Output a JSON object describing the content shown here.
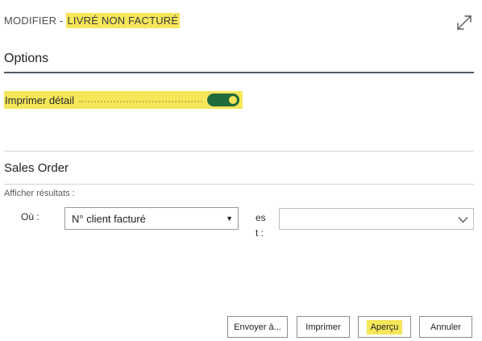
{
  "header": {
    "title_prefix": "MODIFIER -",
    "title_record": "LIVRÉ NON FACTURÉ",
    "expand_icon": "expand-diagonal-icon"
  },
  "options": {
    "heading": "Options",
    "print_detail_label": "Imprimer détail",
    "print_detail_enabled": true,
    "toggle_color": "#1f6b3b",
    "highlight_color": "#f5e65a"
  },
  "sales_order": {
    "heading": "Sales Order",
    "results_label": "Afficher résultats :",
    "where_label": "Où :",
    "field_value": "N° client facturé",
    "operator_label": "est :",
    "filter_value": ""
  },
  "buttons": {
    "send": "Envoyer à...",
    "print": "Imprimer",
    "preview": "Aperçu",
    "cancel": "Annuler"
  }
}
